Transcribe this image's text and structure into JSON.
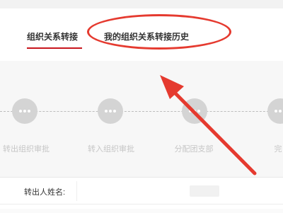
{
  "tabs": [
    {
      "label": "组织关系转接",
      "active": true
    },
    {
      "label": "我的组织关系转接历史",
      "active": false
    }
  ],
  "steps": [
    {
      "label": "转出组织审批",
      "icon": "more-dots-icon"
    },
    {
      "label": "转入组织审批",
      "icon": "more-dots-icon"
    },
    {
      "label": "分配团支部",
      "icon": "more-dots-icon"
    },
    {
      "label": "完",
      "icon": "more-dots-icon"
    }
  ],
  "form": {
    "transfer_out_name_label": "转出人姓名:"
  },
  "colors": {
    "accent_red": "#c8161d",
    "annotation_red": "#e53a2f",
    "step_inactive": "#d4d4d4"
  }
}
